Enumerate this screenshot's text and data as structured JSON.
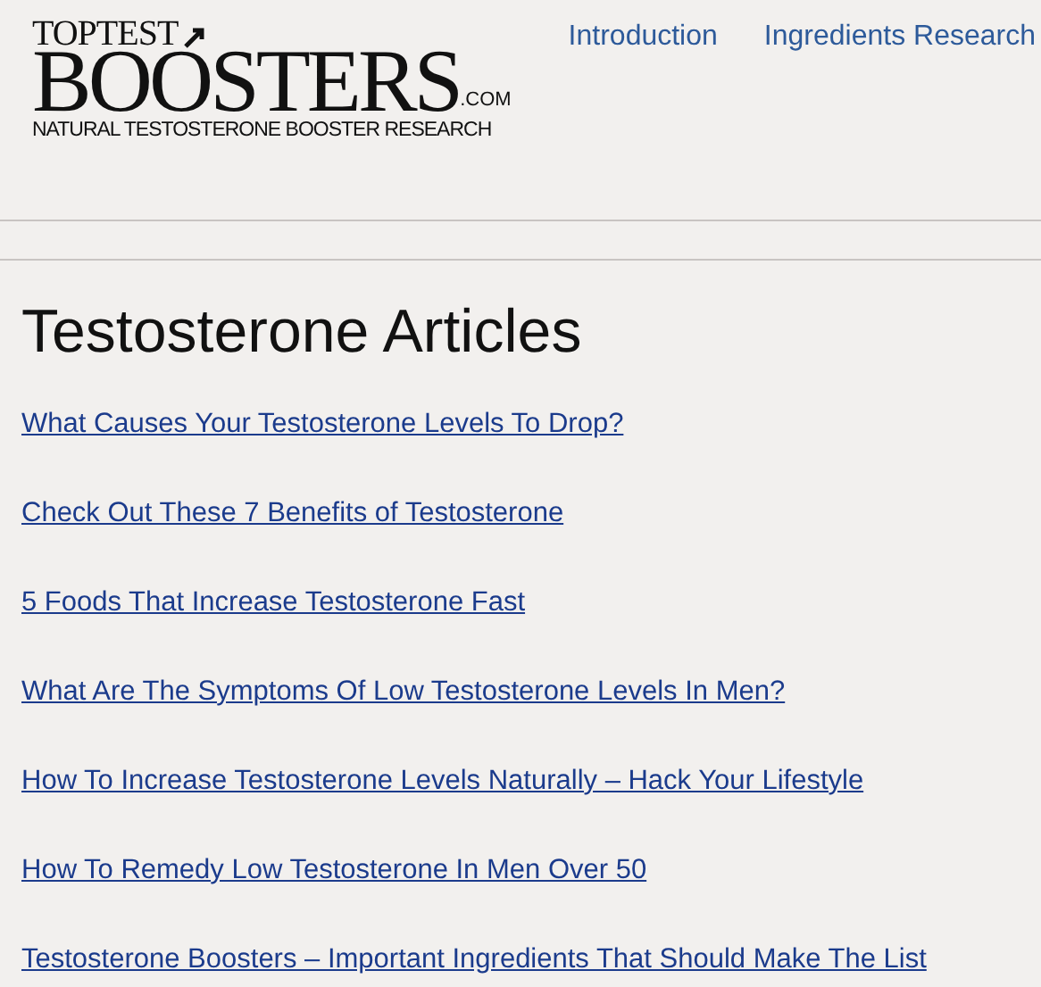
{
  "logo": {
    "top": "TOPTEST",
    "main": "BOOSTERS",
    "suffix": ".COM",
    "tagline": "NATURAL TESTOSTERONE BOOSTER RESEARCH"
  },
  "nav": [
    "Introduction",
    "Ingredients Research"
  ],
  "heading": "Testosterone Articles",
  "articles": [
    "What Causes Your Testosterone Levels To Drop?",
    "Check Out These 7 Benefits of Testosterone",
    "5 Foods That Increase Testosterone Fast",
    "What Are The Symptoms Of Low Testosterone Levels In Men?",
    "How To Increase Testosterone Levels Naturally – Hack Your Lifestyle",
    "How To Remedy Low Testosterone In Men Over 50",
    "Testosterone Boosters – Important Ingredients That Should Make The List"
  ]
}
